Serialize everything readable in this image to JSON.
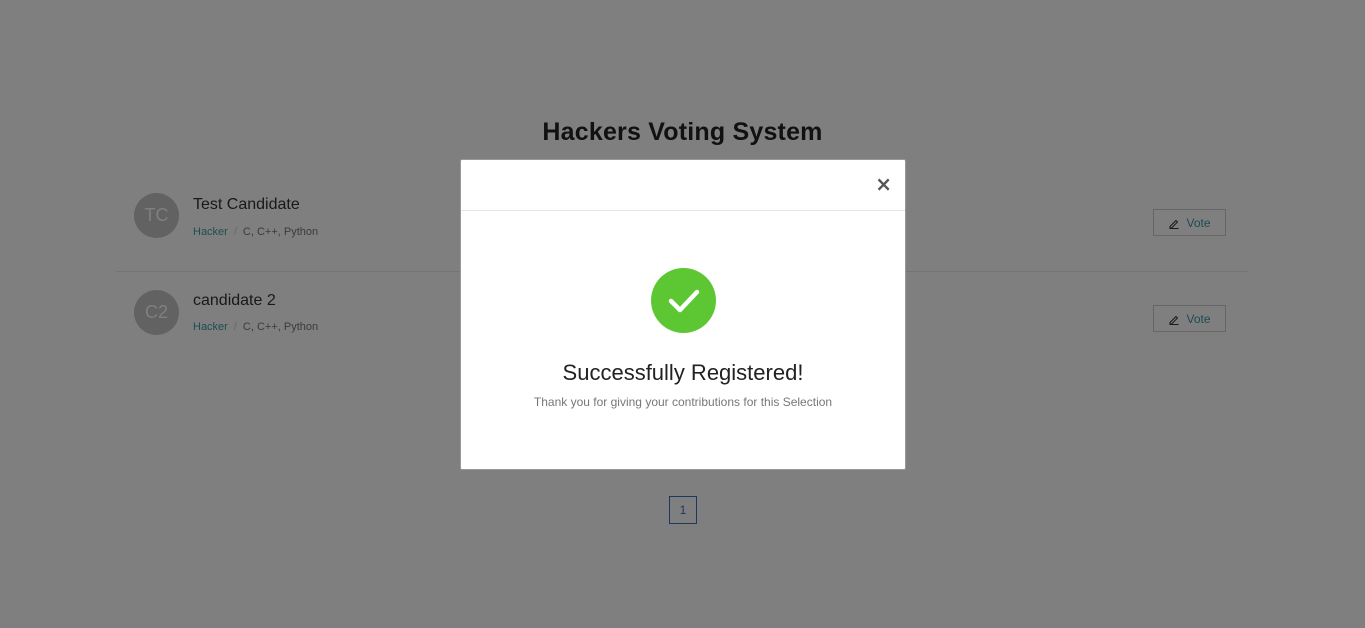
{
  "page": {
    "title": "Hackers Voting System"
  },
  "candidates": [
    {
      "initials": "TC",
      "name": "Test Candidate",
      "role": "Hacker",
      "skills": "C, C++, Python",
      "vote_label": "Vote"
    },
    {
      "initials": "C2",
      "name": "candidate 2",
      "role": "Hacker",
      "skills": "C, C++, Python",
      "vote_label": "Vote"
    }
  ],
  "pagination": {
    "current_page": "1"
  },
  "modal": {
    "close_label": "×",
    "icon": "check-circle-icon",
    "title": "Successfully Registered!",
    "message": "Thank you for giving your contributions for this Selection"
  },
  "colors": {
    "accent": "#3b99a6",
    "success": "#5cc733",
    "pagination": "#3b6fbf",
    "overlay": "rgba(0,0,0,0.5)"
  }
}
